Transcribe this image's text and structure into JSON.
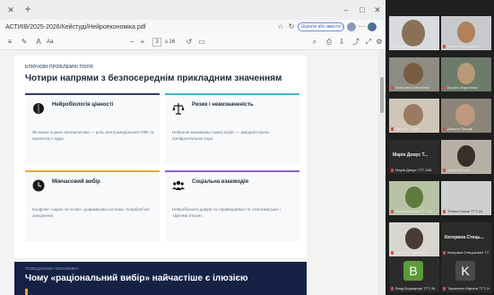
{
  "browser": {
    "url": "АСТИІВ/2025-2026/Кейстуді/Нейроекономіка.pdf",
    "search_placeholder": "Шукати або ввести URL",
    "page_number": "3",
    "page_total": "з 16",
    "zoom_label": "Аа"
  },
  "pdf": {
    "page1": {
      "eyebrow": "КЛЮЧОВІ ПРОБЛЕМНІ ПОЛЯ",
      "title": "Чотири напрями з безпосереднім прикладним значенням",
      "cards": [
        {
          "title": "Нейробіологія цінності",
          "text": "Як мозок оцінює альтернативи — роль вентромедіальної ПФК та прилеглого ядра.",
          "color": "#2c3e66"
        },
        {
          "title": "Ризик і невизначеність",
          "text": "Нейронні механізми страху втрат — амігдала проти префронтальної кори.",
          "color": "#3fb6c8"
        },
        {
          "title": "Міжчасовий вибір",
          "text": "Конфлікт «зараз чи потім»: дофамінова система і гіперболічне знецінення.",
          "color": "#e5a93a"
        },
        {
          "title": "Соціальна взаємодія",
          "text": "Нейробіологія довіри та справедливості в «Ультиматумі» і «Дилемі в'язня».",
          "color": "#8a5fc8"
        }
      ]
    },
    "page2": {
      "eyebrow": "ПОВЕДІНКОВА ЕКОНОМІКА",
      "title": "Чому «раціональний вибір» найчастіше є ілюзією"
    }
  },
  "participants": [
    {
      "name": "Олег Смовський"
    },
    {
      "name": "Марина Кузьменко"
    },
    {
      "name": "Катерина Коваленко"
    },
    {
      "name": "Василь Мартинюк"
    },
    {
      "name": "Лілія ТТТ-248"
    },
    {
      "name": "Данило Проців"
    },
    {
      "name": "Марія Демус ТТТ-248"
    },
    {
      "name": "Аліна Антонів"
    },
    {
      "name": "Вероніка Сава ТТТ-24"
    },
    {
      "name": "Тетяна Лазар ТТТ-24"
    },
    {
      "name": "Світлана Марченко"
    },
    {
      "name": "Катерина Стецькевич ТТТ-24"
    },
    {
      "name": "Влад Боднарчук ТТТ-34",
      "letter": "B",
      "color": "#5c9a3a"
    },
    {
      "name": "Тарасенко Карина ТТТ-24",
      "letter": "K",
      "color": "#4a4a4a"
    }
  ],
  "name_tiles": {
    "maria": "Марія Демус Т...",
    "kateryna": "Катерина  Стець..."
  }
}
